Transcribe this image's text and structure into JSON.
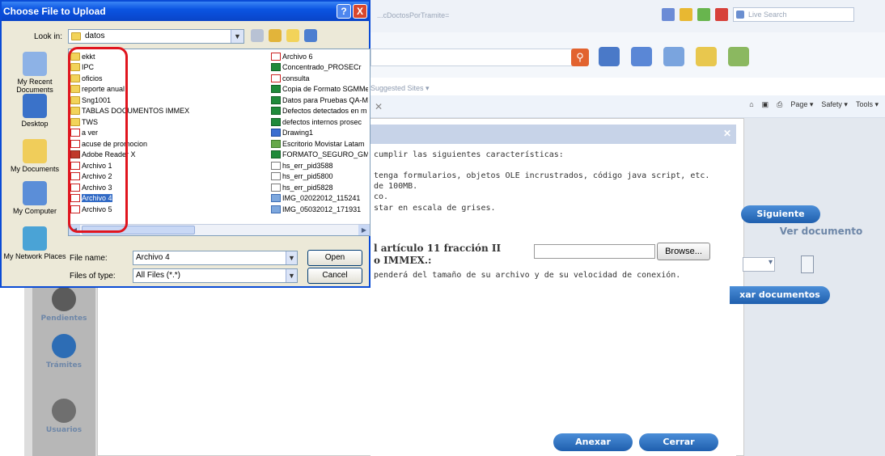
{
  "browser": {
    "address_fragment": "...cDoctosPorTramite=",
    "live_search_placeholder": "Live Search",
    "suggested_sites": "Suggested Sites ▾",
    "menu_page": "Page ▾",
    "menu_safety": "Safety ▾",
    "menu_tools": "Tools ▾"
  },
  "app": {
    "intro": "cumplir las siguientes características:",
    "line1": "tenga formularios, objetos OLE incrustrados, código java script, etc.",
    "line2": "de 100MB.",
    "line3": "co.",
    "line4": "star en escala de grises.",
    "article_line1": "l artículo 11 fracción II",
    "article_line2": "o IMMEX.:",
    "note": "penderá del tamaño de su archivo y de su velocidad de conexión.",
    "browse_button": "Browse...",
    "siguiente_button": "Siguiente",
    "ver_documento": "Ver documento",
    "anexar_documentos": "xar documentos",
    "anexar_button": "Anexar",
    "cerrar_button": "Cerrar",
    "sidebar": {
      "pendientes": "Pendientes",
      "tramites": "Trámites",
      "usuarios": "Usuarios"
    }
  },
  "dialog": {
    "title": "Choose File to Upload",
    "help_button": "?",
    "close_button": "X",
    "look_in_label": "Look in:",
    "look_in_value": "datos",
    "places": [
      {
        "label": "My Recent Documents",
        "icon": "recent-documents-icon"
      },
      {
        "label": "Desktop",
        "icon": "desktop-icon"
      },
      {
        "label": "My Documents",
        "icon": "my-documents-icon"
      },
      {
        "label": "My Computer",
        "icon": "my-computer-icon"
      },
      {
        "label": "My Network Places",
        "icon": "network-places-icon"
      }
    ],
    "files_col1": [
      {
        "name": "ekkt",
        "type": "folder"
      },
      {
        "name": "IPC",
        "type": "folder"
      },
      {
        "name": "oficios",
        "type": "folder"
      },
      {
        "name": "reporte anual",
        "type": "folder"
      },
      {
        "name": "Sng1001",
        "type": "folder"
      },
      {
        "name": "TABLAS DOCUMENTOS IMMEX",
        "type": "folder"
      },
      {
        "name": "TWS",
        "type": "folder"
      },
      {
        "name": "a ver",
        "type": "pdf"
      },
      {
        "name": "acuse de promocion",
        "type": "pdf"
      },
      {
        "name": "Adobe Reader X",
        "type": "app"
      },
      {
        "name": "Archivo 1",
        "type": "pdf"
      },
      {
        "name": "Archivo 2",
        "type": "pdf"
      },
      {
        "name": "Archivo 3",
        "type": "pdf"
      },
      {
        "name": "Archivo 4",
        "type": "pdf",
        "selected": true
      },
      {
        "name": "Archivo 5",
        "type": "pdf"
      }
    ],
    "files_col2": [
      {
        "name": "Archivo 6",
        "type": "pdf"
      },
      {
        "name": "Concentrado_PROSECr",
        "type": "excel"
      },
      {
        "name": "consulta",
        "type": "pdf"
      },
      {
        "name": "Copia de Formato SGMMec",
        "type": "excel"
      },
      {
        "name": "Datos para Pruebas QA-M",
        "type": "excel"
      },
      {
        "name": "Defectos detectados en m",
        "type": "excel"
      },
      {
        "name": "defectos internos prosec",
        "type": "excel"
      },
      {
        "name": "Drawing1",
        "type": "visio"
      },
      {
        "name": "Escritorio Movistar Latam",
        "type": "shortcut"
      },
      {
        "name": "FORMATO_SEGURO_GMM",
        "type": "excel"
      },
      {
        "name": "hs_err_pid3588",
        "type": "txt"
      },
      {
        "name": "hs_err_pid5800",
        "type": "txt"
      },
      {
        "name": "hs_err_pid5828",
        "type": "txt"
      },
      {
        "name": "IMG_02022012_115241",
        "type": "img"
      },
      {
        "name": "IMG_05032012_171931",
        "type": "img"
      }
    ],
    "file_name_label": "File name:",
    "file_name_value": "Archivo 4",
    "file_type_label": "Files of type:",
    "file_type_value": "All Files (*.*)",
    "open_button": "Open",
    "cancel_button": "Cancel"
  }
}
